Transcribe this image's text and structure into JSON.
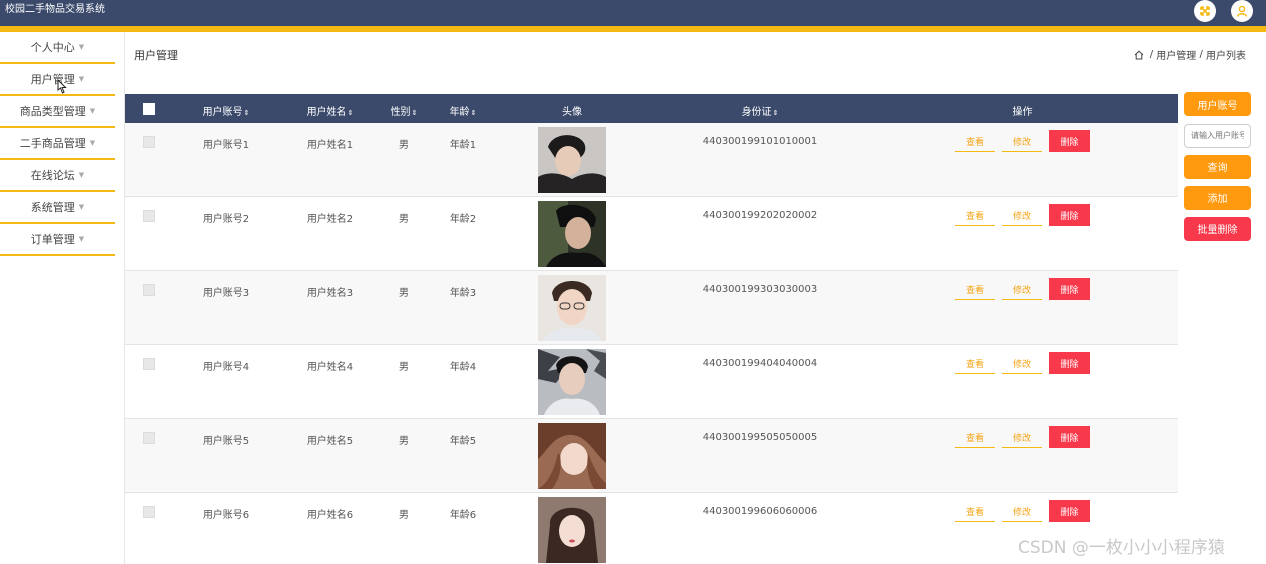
{
  "app": {
    "title": "校园二手物品交易系统"
  },
  "colors": {
    "header_bg": "#3b4a6b",
    "accent": "#f5b913",
    "button_orange": "#ff9a0f",
    "danger": "#f7394b"
  },
  "top_icons": [
    {
      "icon": "expand-arrows-icon"
    },
    {
      "icon": "user-icon"
    }
  ],
  "sidebar": {
    "items": [
      {
        "label": "个人中心"
      },
      {
        "label": "用户管理"
      },
      {
        "label": "商品类型管理"
      },
      {
        "label": "二手商品管理"
      },
      {
        "label": "在线论坛"
      },
      {
        "label": "系统管理"
      },
      {
        "label": "订单管理"
      }
    ]
  },
  "page": {
    "title": "用户管理",
    "breadcrumb": [
      "用户管理",
      "用户列表"
    ]
  },
  "table": {
    "columns": [
      "用户账号",
      "用户姓名",
      "性别",
      "年龄",
      "头像",
      "身份证",
      "操作"
    ],
    "rows": [
      {
        "account": "用户账号1",
        "name": "用户姓名1",
        "sex": "男",
        "age": "年龄1",
        "id_card": "440300199101010001"
      },
      {
        "account": "用户账号2",
        "name": "用户姓名2",
        "sex": "男",
        "age": "年龄2",
        "id_card": "440300199202020002"
      },
      {
        "account": "用户账号3",
        "name": "用户姓名3",
        "sex": "男",
        "age": "年龄3",
        "id_card": "440300199303030003"
      },
      {
        "account": "用户账号4",
        "name": "用户姓名4",
        "sex": "男",
        "age": "年龄4",
        "id_card": "440300199404040004"
      },
      {
        "account": "用户账号5",
        "name": "用户姓名5",
        "sex": "男",
        "age": "年龄5",
        "id_card": "440300199505050005"
      },
      {
        "account": "用户账号6",
        "name": "用户姓名6",
        "sex": "男",
        "age": "年龄6",
        "id_card": "440300199606060006"
      }
    ],
    "actions": {
      "view": "查看",
      "edit": "修改",
      "delete": "删除"
    }
  },
  "search_panel": {
    "field_label": "用户账号",
    "input_placeholder": "请输入用户账号",
    "query_label": "查询",
    "add_label": "添加",
    "batch_delete_label": "批量删除"
  },
  "watermark": "CSDN @一枚小小小程序猿"
}
